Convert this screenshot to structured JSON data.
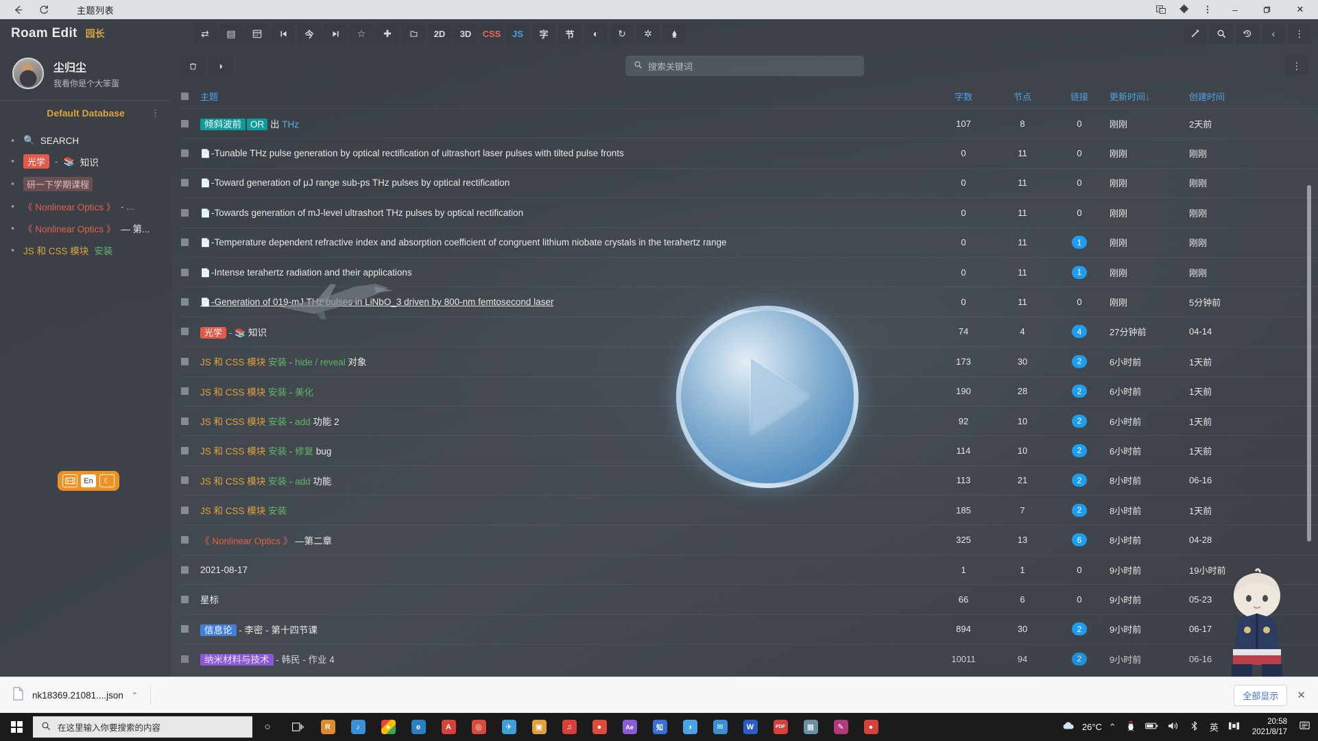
{
  "browser": {
    "tab_title": "主题列表",
    "back_icon": "back-arrow-icon",
    "reload_icon": "reload-icon",
    "translate_icon": "translate-icon",
    "extensions_icon": "puzzle-piece-icon",
    "menu_icon": "kebab-menu-icon",
    "minimize": "–",
    "maximize": "❐",
    "close": "✕"
  },
  "app": {
    "brand": "Roam Edit",
    "brand_badge": "园长",
    "toolbar_left": [
      {
        "name": "swap-icon",
        "glyph": "⇄"
      },
      {
        "name": "card-icon",
        "glyph": "⌸"
      },
      {
        "name": "calendar-icon",
        "glyph": "Ὄ5"
      },
      {
        "name": "skip-previous-icon",
        "glyph": "⏮"
      },
      {
        "name": "today-icon",
        "glyph": "今"
      },
      {
        "name": "skip-next-icon",
        "glyph": "⏭"
      },
      {
        "name": "star-icon",
        "glyph": "☆"
      },
      {
        "name": "add-icon",
        "glyph": "✚"
      },
      {
        "name": "folder-icon",
        "glyph": "▭"
      },
      {
        "name": "graph-2d-icon",
        "glyph": "2D"
      },
      {
        "name": "graph-3d-icon",
        "glyph": "3D"
      },
      {
        "name": "css-icon",
        "glyph": "CSS"
      },
      {
        "name": "js-icon",
        "glyph": "JS"
      },
      {
        "name": "font-icon",
        "glyph": "字"
      },
      {
        "name": "section-icon",
        "glyph": "节"
      },
      {
        "name": "contrast-icon",
        "glyph": "◐"
      },
      {
        "name": "sync-icon",
        "glyph": "↻"
      },
      {
        "name": "settings-icon",
        "glyph": "⚙"
      },
      {
        "name": "ink-icon",
        "glyph": "✒"
      }
    ],
    "toolbar_right": [
      {
        "name": "magic-wand-icon",
        "glyph": "✐"
      },
      {
        "name": "search-icon",
        "glyph": "ὐD"
      },
      {
        "name": "history-icon",
        "glyph": "↺"
      },
      {
        "name": "collapse-left-icon",
        "glyph": "‹"
      },
      {
        "name": "kebab-menu-icon",
        "glyph": "⋮"
      }
    ]
  },
  "sidebar": {
    "profile": {
      "name": "尘归尘",
      "signature": "我看你是个大笨蛋",
      "avatar": "user-avatar"
    },
    "database": {
      "label": "Default Database",
      "more_icon": "kebab-menu-icon"
    },
    "items": [
      {
        "label": "SEARCH",
        "icon": "magnifier-emoji",
        "style": "plain"
      },
      {
        "label": "光学",
        "suffix": "知识",
        "sep": "-",
        "icon": "books-emoji",
        "style": "tag-red"
      },
      {
        "label": "研一下学期课程",
        "style": "tag-rose"
      },
      {
        "label": "《 Nonlinear Optics 》",
        "suffix": "- ...",
        "style": "nl-red"
      },
      {
        "label": "《 Nonlinear Optics 》",
        "suffix": "— 第...",
        "style": "nl-red"
      },
      {
        "label": "JS 和 CSS 模块",
        "suffix": "安装",
        "style": "js"
      }
    ],
    "lang_toggle": {
      "keyboard": "keyboard-icon",
      "en": "En",
      "moon": "moon-icon"
    }
  },
  "content_toolbar": {
    "trash_icon": "trash-icon",
    "filter_icon": "contrast-filter-icon",
    "more_icon": "kebab-menu-icon",
    "search": {
      "placeholder": "搜索关键词",
      "value": "",
      "icon": "search-icon"
    }
  },
  "table": {
    "columns": [
      {
        "key": "title",
        "label": "主题"
      },
      {
        "key": "words",
        "label": "字数"
      },
      {
        "key": "nodes",
        "label": "节点"
      },
      {
        "key": "links",
        "label": "链接"
      },
      {
        "key": "updated",
        "label": "更新时间",
        "sort": "↓"
      },
      {
        "key": "created",
        "label": "创建时间"
      }
    ],
    "rows": [
      {
        "title": "倾斜波前 OR 出 THz",
        "kind": "tagged-thz",
        "words": "107",
        "nodes": "8",
        "links": "0",
        "updated": "刚刚",
        "created": "2天前"
      },
      {
        "title": "-Tunable THz pulse generation by optical rectification of ultrashort laser pulses with tilted pulse fronts",
        "kind": "doc",
        "words": "0",
        "nodes": "11",
        "links": "0",
        "updated": "刚刚",
        "created": "刚刚"
      },
      {
        "title": "-Toward generation of μJ range sub-ps THz pulses by optical rectification",
        "kind": "doc",
        "words": "0",
        "nodes": "11",
        "links": "0",
        "updated": "刚刚",
        "created": "刚刚"
      },
      {
        "title": "-Towards generation of mJ-level ultrashort THz pulses by optical rectification",
        "kind": "doc",
        "words": "0",
        "nodes": "11",
        "links": "0",
        "updated": "刚刚",
        "created": "刚刚"
      },
      {
        "title": "-Temperature dependent refractive index and absorption coefficient of congruent lithium niobate crystals in the terahertz range",
        "kind": "doc",
        "words": "0",
        "nodes": "11",
        "links": "1",
        "updated": "刚刚",
        "created": "刚刚"
      },
      {
        "title": "-Intense terahertz radiation and their applications",
        "kind": "doc",
        "words": "0",
        "nodes": "11",
        "links": "1",
        "updated": "刚刚",
        "created": "刚刚"
      },
      {
        "title": "-Generation of 019-mJ THz pulses in LiNbO_3 driven by 800-nm femtosecond laser",
        "kind": "doc-underline",
        "words": "0",
        "nodes": "11",
        "links": "0",
        "updated": "刚刚",
        "created": "5分钟前"
      },
      {
        "title": "光学 - 知识",
        "kind": "optics-knowledge",
        "words": "74",
        "nodes": "4",
        "links": "4",
        "updated": "27分钟前",
        "created": "04-14"
      },
      {
        "title": "JS 和 CSS 模块 安装 - hide / reveal 对象",
        "kind": "js",
        "words": "173",
        "nodes": "30",
        "links": "2",
        "updated": "6小时前",
        "created": "1天前"
      },
      {
        "title": "JS 和 CSS 模块 安装 - 美化",
        "kind": "js",
        "words": "190",
        "nodes": "28",
        "links": "2",
        "updated": "6小时前",
        "created": "1天前"
      },
      {
        "title": "JS 和 CSS 模块 安装 - add 功能 2",
        "kind": "js",
        "words": "92",
        "nodes": "10",
        "links": "2",
        "updated": "6小时前",
        "created": "1天前"
      },
      {
        "title": "JS 和 CSS 模块 安装 - 修复 bug",
        "kind": "js",
        "words": "114",
        "nodes": "10",
        "links": "2",
        "updated": "6小时前",
        "created": "1天前"
      },
      {
        "title": "JS 和 CSS 模块 安装 - add 功能",
        "kind": "js",
        "words": "113",
        "nodes": "21",
        "links": "2",
        "updated": "8小时前",
        "created": "06-16"
      },
      {
        "title": "JS 和 CSS 模块 安装",
        "kind": "js",
        "words": "185",
        "nodes": "7",
        "links": "2",
        "updated": "8小时前",
        "created": "1天前"
      },
      {
        "title": "《 Nonlinear Optics 》 —第二章",
        "kind": "nonlinear",
        "words": "325",
        "nodes": "13",
        "links": "6",
        "updated": "8小时前",
        "created": "04-28"
      },
      {
        "title": "2021-08-17",
        "kind": "plain",
        "words": "1",
        "nodes": "1",
        "links": "0",
        "updated": "9小时前",
        "created": "19小时前"
      },
      {
        "title": "星标",
        "kind": "plain",
        "words": "66",
        "nodes": "6",
        "links": "0",
        "updated": "9小时前",
        "created": "05-23"
      },
      {
        "title": "信息论 - 李密 - 第十四节课",
        "kind": "info-theory",
        "words": "894",
        "nodes": "30",
        "links": "2",
        "updated": "9小时前",
        "created": "06-17"
      },
      {
        "title": "纳米材料与技术 - 韩民 - 作业 4",
        "kind": "nano",
        "words": "10011",
        "nodes": "94",
        "links": "2",
        "updated": "9小时前",
        "created": "06-16"
      }
    ]
  },
  "video_overlay": {
    "play_icon": "play-button-icon"
  },
  "downloads": {
    "file_icon": "file-icon",
    "filename": "nk18369.21081....json",
    "caret_icon": "chevron-up-icon",
    "show_all": "全部显示",
    "close_icon": "close-icon"
  },
  "taskbar": {
    "start_icon": "windows-start-icon",
    "search_placeholder": "在这里输入你要搜索的内容",
    "search_icon": "search-icon",
    "cortana_icon": "cortana-circle-icon",
    "taskview_icon": "task-view-icon",
    "apps": [
      {
        "name": "roam-edit-app",
        "glyph": "R",
        "color": "#e08a2e"
      },
      {
        "name": "media-app",
        "glyph": "♪",
        "color": "#3a8fd6"
      },
      {
        "name": "chrome-app",
        "glyph": "●",
        "color": "#3c9ae8"
      },
      {
        "name": "edge-app",
        "glyph": "e",
        "color": "#2a7fc7"
      },
      {
        "name": "pdf-app",
        "glyph": "A",
        "color": "#d8413a"
      },
      {
        "name": "wechat-app",
        "glyph": "◎",
        "color": "#d84a3a"
      },
      {
        "name": "telegram-app",
        "glyph": "✈",
        "color": "#3fa0d8"
      },
      {
        "name": "folder-app",
        "glyph": "▣",
        "color": "#e0a33c"
      },
      {
        "name": "netease-app",
        "glyph": "♫",
        "color": "#d8413a"
      },
      {
        "name": "qq-app",
        "glyph": "●",
        "color": "#e04a3a"
      },
      {
        "name": "after-effects-app",
        "glyph": "Ae",
        "color": "#8a5bd8"
      },
      {
        "name": "zhihu-app",
        "glyph": "知",
        "color": "#3a6fd8"
      },
      {
        "name": "paint-app",
        "glyph": "◑",
        "color": "#4aa3e8"
      },
      {
        "name": "mail-app",
        "glyph": "✉",
        "color": "#3a8fd6"
      },
      {
        "name": "word-app",
        "glyph": "W",
        "color": "#2a5fc7"
      },
      {
        "name": "pdf2-app",
        "glyph": "PDF",
        "color": "#d8413a"
      },
      {
        "name": "camera-app",
        "glyph": "▦",
        "color": "#6a8fa0"
      },
      {
        "name": "pen-app",
        "glyph": "✎",
        "color": "#b03a7a"
      },
      {
        "name": "record-app",
        "glyph": "●",
        "color": "#d8413a"
      }
    ],
    "tray": {
      "weather_icon": "cloud-icon",
      "temperature": "26°C",
      "chevron_icon": "chevron-up-icon",
      "qq_icon": "penguin-icon",
      "battery_icon": "battery-icon",
      "volume_icon": "volume-icon",
      "network_icon": "bluetooth-icon",
      "ime_icon": "英",
      "layout_icon": "layout-icon",
      "time": "20:58",
      "date": "2021/8/17",
      "notification_icon": "notification-icon"
    }
  }
}
